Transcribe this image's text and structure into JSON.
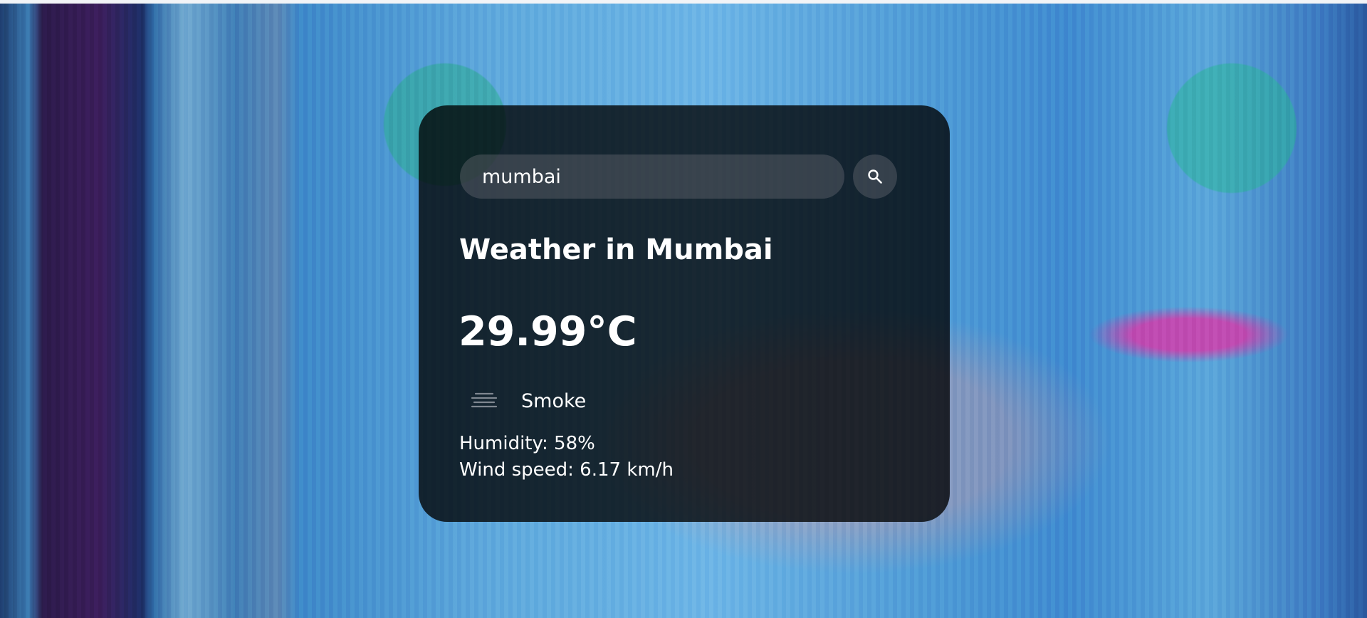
{
  "search": {
    "value": "mumbai",
    "button_icon": "search-icon"
  },
  "weather": {
    "title": "Weather in Mumbai",
    "temperature": "29.99°C",
    "icon": "haze-icon",
    "description": "Smoke",
    "humidity": "Humidity: 58%",
    "wind": "Wind speed: 6.17 km/h"
  },
  "colors": {
    "card_background": "#000000",
    "text": "#ffffff"
  }
}
